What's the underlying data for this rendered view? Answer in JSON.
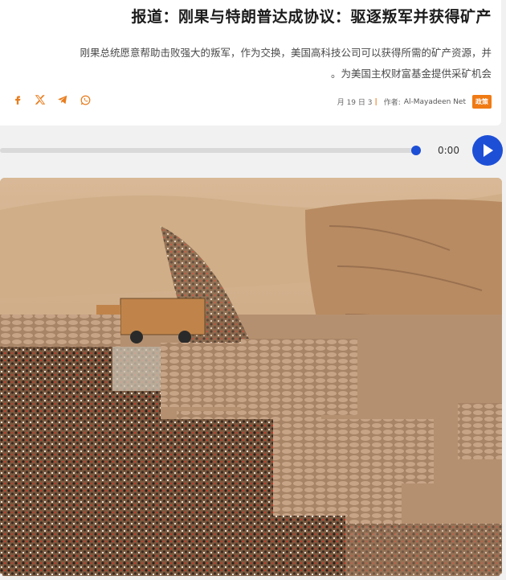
{
  "article": {
    "title": "报道：刚果与特朗普达成协议：驱逐叛军并获得矿产",
    "summary_line1": "刚果总统愿意帮助击败强大的叛军，作为交换，美国高科技公司可以获得所需的矿产资源，并",
    "summary_line2": "。为美国主权财富基金提供采矿机会",
    "date": "月 19 日 3",
    "date_separator": "|",
    "author_label": "作者:",
    "author": "Al-Mayadeen Net",
    "tag": "政策"
  },
  "share": {
    "icons": [
      "facebook-icon",
      "x-icon",
      "telegram-icon",
      "whatsapp-icon"
    ],
    "accent": "#e87d1e"
  },
  "player": {
    "time": "0:00",
    "progress_percent": 100,
    "accent": "#1d4fd6"
  },
  "photo": {
    "description_colors": [
      "#c8a27a",
      "#a37a52",
      "#8a6a4a"
    ]
  }
}
